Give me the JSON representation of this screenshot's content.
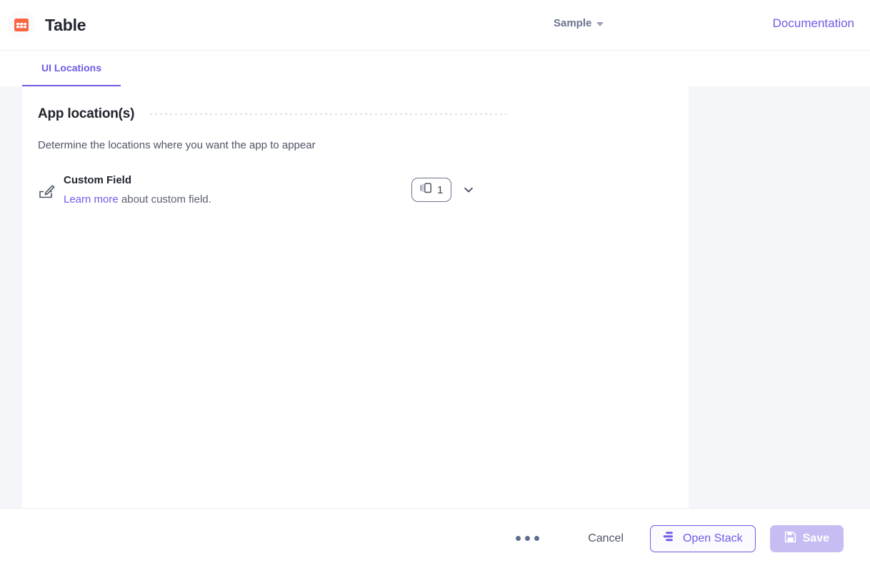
{
  "header": {
    "logo_icon": "table-grid-icon",
    "logo_color": "#fa6441",
    "title": "Table",
    "environment": {
      "label": "Sample",
      "caret_icon": "caret-down-icon"
    },
    "documentation_label": "Documentation",
    "link_color": "#6c5ce7"
  },
  "tabs": [
    {
      "label": "UI Locations",
      "active": true
    }
  ],
  "main": {
    "section": {
      "title": "App location(s)",
      "description": "Determine the locations where you want the app to appear"
    },
    "locations": [
      {
        "icon": "custom-field-icon",
        "name": "Custom Field",
        "link_text": "Learn more",
        "sub_text_rest": " about custom field.",
        "count": "1",
        "count_icon": "panel-layout-icon",
        "expand_icon": "chevron-down-icon"
      }
    ]
  },
  "footer": {
    "more_label": "more-options",
    "more_icon": "ellipsis-icon",
    "cancel_label": "Cancel",
    "open_stack_label": "Open Stack",
    "open_stack_icon": "stack-icon",
    "save_label": "Save",
    "save_icon": "floppy-save-icon",
    "save_disabled": true
  },
  "colors": {
    "accent": "#6c5ce7",
    "brand": "#fa6441",
    "page_bg": "#f5f6fa",
    "panel_bg": "#ffffff"
  }
}
